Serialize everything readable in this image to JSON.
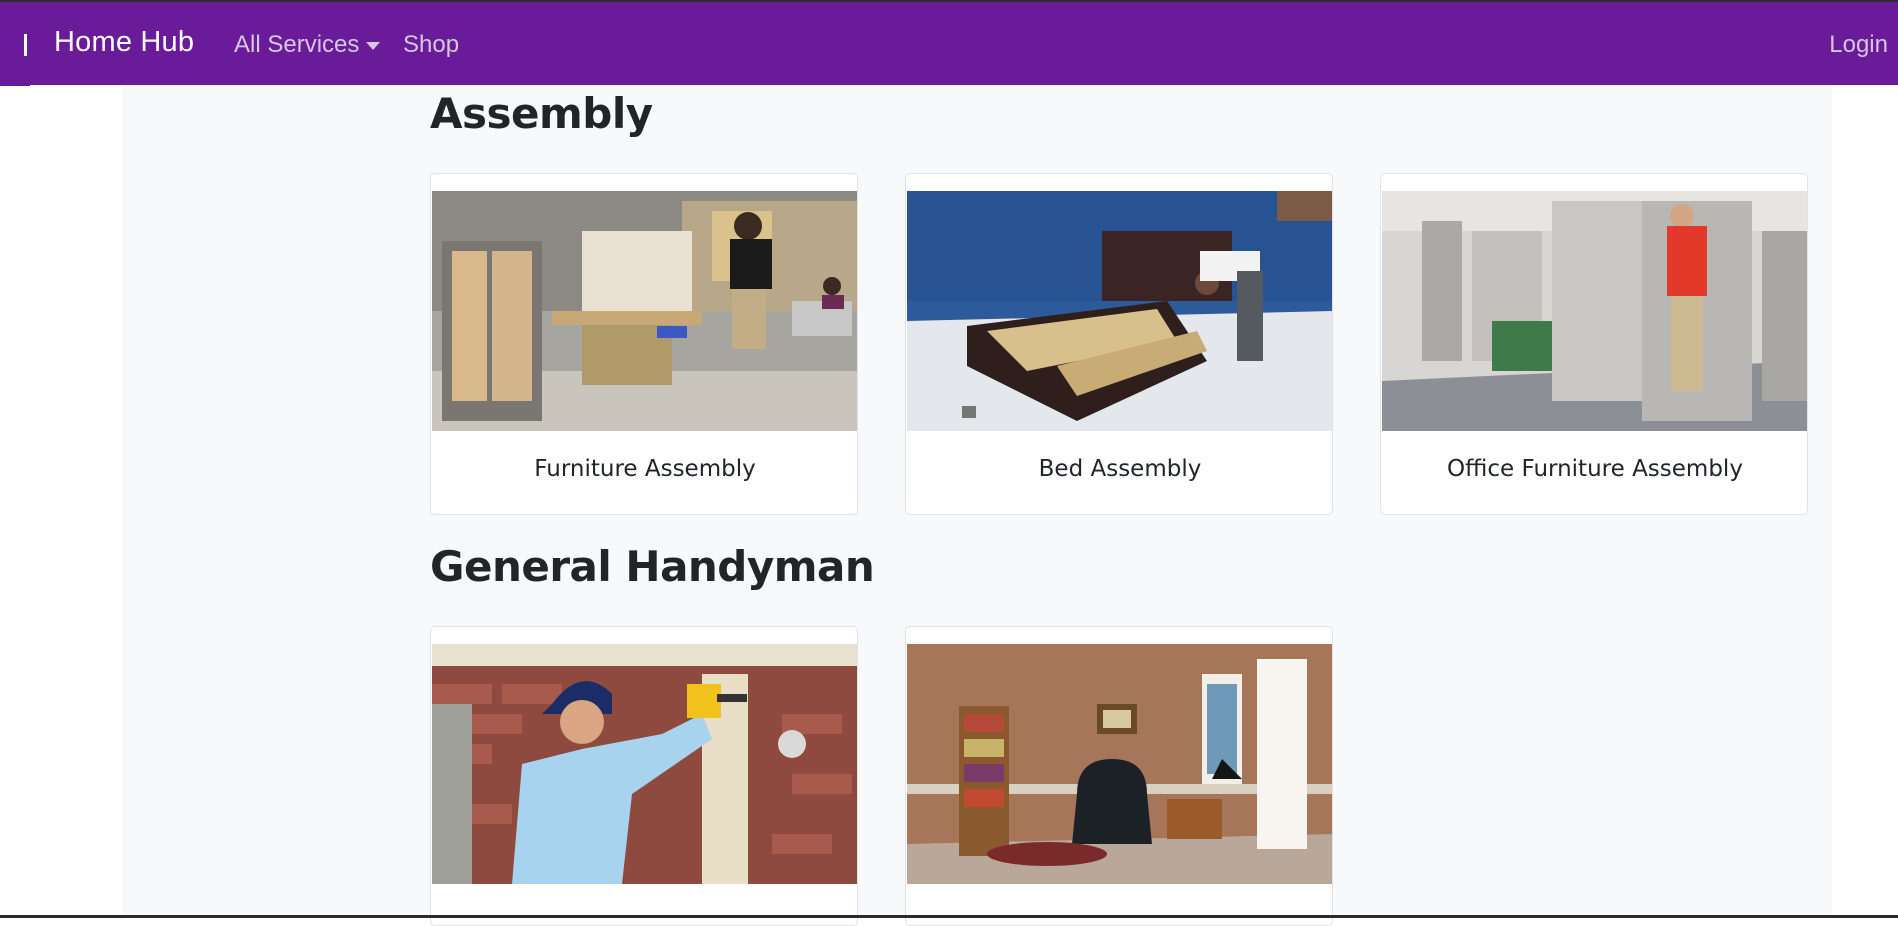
{
  "navbar": {
    "brand": "Home Hub",
    "services_label": "All Services",
    "shop_label": "Shop",
    "login_label": "Login",
    "background": "#6a1b9a"
  },
  "sections": [
    {
      "title": "Assembly",
      "cards": [
        {
          "label": "Furniture Assembly",
          "image": "workshop-furniture-assembly-photo"
        },
        {
          "label": "Bed Assembly",
          "image": "bed-frame-assembly-photo"
        },
        {
          "label": "Office Furniture Assembly",
          "image": "office-cubicle-assembly-photo"
        }
      ]
    },
    {
      "title": "General Handyman",
      "cards": [
        {
          "label": "",
          "image": "gutter-drilling-photo"
        },
        {
          "label": "",
          "image": "living-room-photo"
        }
      ]
    }
  ]
}
